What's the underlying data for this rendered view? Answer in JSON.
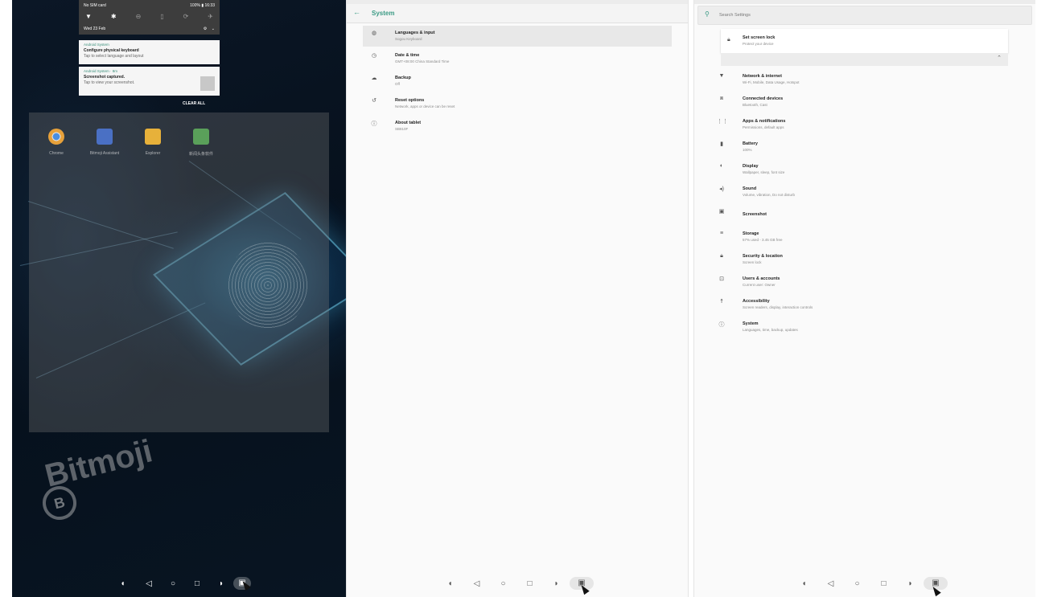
{
  "launcher": {
    "status": {
      "carrier": "No SIM card",
      "battery": "100%",
      "time": "16:33",
      "date": "Wed 23 Feb"
    },
    "notifications": [
      {
        "source": "Android System",
        "title": "Configure physical keyboard",
        "subtitle": "Tap to select language and layout"
      },
      {
        "source": "Android System · 8m",
        "title": "Screenshot captured.",
        "subtitle": "Tap to view your screenshot."
      }
    ],
    "clear_all": "CLEAR ALL",
    "apps": [
      {
        "label": "Chrome",
        "color": "#e7a13a"
      },
      {
        "label": "Bitmoji Assistant",
        "color": "#4a70c4"
      },
      {
        "label": "Explorer",
        "color": "#e7b13a"
      },
      {
        "label": "新闻头条软件",
        "color": "#5aa05a"
      }
    ],
    "brand": "Bitmoji",
    "icons": {
      "wifi": "wifi-icon",
      "bluetooth": "bluetooth-icon",
      "dnd": "do-not-disturb-icon",
      "flashlight": "flashlight-icon",
      "rotate": "auto-rotate-icon",
      "airplane": "airplane-icon"
    }
  },
  "system_settings": {
    "title": "System",
    "items": [
      {
        "title": "Languages & input",
        "subtitle": "Sogou Keyboard",
        "icon": "globe-icon"
      },
      {
        "title": "Date & time",
        "subtitle": "GMT+08:00 China Standard Time",
        "icon": "clock-icon"
      },
      {
        "title": "Backup",
        "subtitle": "Off",
        "icon": "cloud-upload-icon"
      },
      {
        "title": "Reset options",
        "subtitle": "Network, apps or device can be reset",
        "icon": "history-icon"
      },
      {
        "title": "About tablet",
        "subtitle": "SB810F",
        "icon": "info-icon"
      }
    ]
  },
  "settings_home": {
    "search_placeholder": "Search Settings",
    "screen_lock": {
      "title": "Set screen lock",
      "subtitle": "Protect your device"
    },
    "items": [
      {
        "title": "Network & internet",
        "subtitle": "Wi-Fi, Mobile, Data Usage, Hotspot",
        "icon": "wifi-icon"
      },
      {
        "title": "Connected devices",
        "subtitle": "Bluetooth, Cast",
        "icon": "devices-icon"
      },
      {
        "title": "Apps & notifications",
        "subtitle": "Permissions, default apps",
        "icon": "apps-grid-icon"
      },
      {
        "title": "Battery",
        "subtitle": "100%",
        "icon": "battery-icon"
      },
      {
        "title": "Display",
        "subtitle": "Wallpaper, sleep, font size",
        "icon": "brightness-icon"
      },
      {
        "title": "Sound",
        "subtitle": "Volume, vibration, Do not disturb",
        "icon": "volume-icon"
      },
      {
        "title": "Screenshot",
        "subtitle": "",
        "icon": "screenshot-icon"
      },
      {
        "title": "Storage",
        "subtitle": "57% used - 3.45 GB free",
        "icon": "storage-icon"
      },
      {
        "title": "Security & location",
        "subtitle": "Screen lock",
        "icon": "lock-icon"
      },
      {
        "title": "Users & accounts",
        "subtitle": "Current user: Owner",
        "icon": "account-icon"
      },
      {
        "title": "Accessibility",
        "subtitle": "Screen readers, display, interaction controls",
        "icon": "accessibility-icon"
      },
      {
        "title": "System",
        "subtitle": "Languages, time, backup, updates",
        "icon": "info-icon"
      }
    ]
  },
  "accent_color": "#3a9a84"
}
